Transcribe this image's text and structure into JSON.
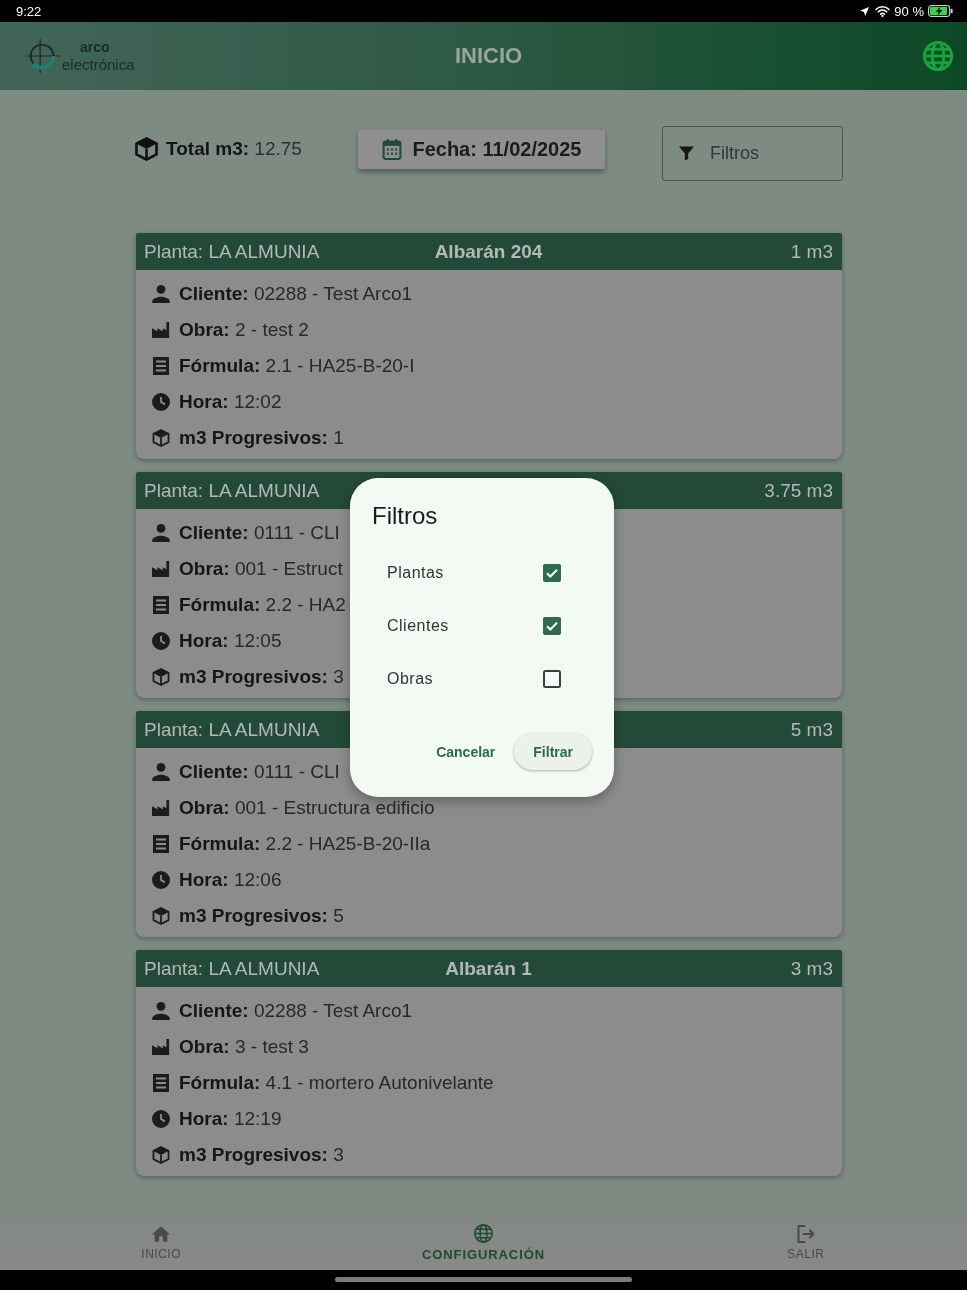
{
  "status_bar": {
    "time": "9:22",
    "battery": "90 %"
  },
  "app_bar": {
    "logo_top": "arco",
    "logo_bottom": "electrónica",
    "title": "INICIO"
  },
  "summary": {
    "total": "**Total m3:** 12.75",
    "date_button": "Fecha: 11/02/2025",
    "filter_button": "Filtros"
  },
  "cards": [
    {
      "plant": "Planta: LA ALMUNIA",
      "delivery_note": "Albarán 204",
      "volume": "1 m3",
      "rows": [
        {
          "kind": "client",
          "text": "**Cliente:** 02288 - Test Arco1"
        },
        {
          "kind": "site",
          "text": "**Obra:** 2 - test 2"
        },
        {
          "kind": "formula",
          "text": "**Fórmula:** 2.1 - HA25-B-20-I"
        },
        {
          "kind": "time",
          "text": "**Hora:** 12:02"
        },
        {
          "kind": "volume",
          "text": "**m3 Progresivos:** 1"
        }
      ]
    },
    {
      "plant": "Planta: LA ALMUNIA",
      "volume": "3.75 m3",
      "rows": [
        {
          "kind": "client",
          "text": "**Cliente:** 0111 - CLI"
        },
        {
          "kind": "site",
          "text": "**Obra:** 001 - Estruct"
        },
        {
          "kind": "formula",
          "text": "**Fórmula:** 2.2 - HA2"
        },
        {
          "kind": "time",
          "text": "**Hora:** 12:05"
        },
        {
          "kind": "volume",
          "text": "**m3 Progresivos:** 3"
        }
      ]
    },
    {
      "plant": "Planta: LA ALMUNIA",
      "volume": "5 m3",
      "rows": [
        {
          "kind": "client",
          "text": "**Cliente:** 0111 - CLI"
        },
        {
          "kind": "site",
          "text": "**Obra:** 001 - Estructura edificio"
        },
        {
          "kind": "formula",
          "text": "**Fórmula:** 2.2 - HA25-B-20-IIa"
        },
        {
          "kind": "time",
          "text": "**Hora:** 12:06"
        },
        {
          "kind": "volume",
          "text": "**m3 Progresivos:** 5"
        }
      ]
    },
    {
      "plant": "Planta: LA ALMUNIA",
      "delivery_note": "Albarán 1",
      "volume": "3 m3",
      "rows": [
        {
          "kind": "client",
          "text": "**Cliente:** 02288 - Test Arco1"
        },
        {
          "kind": "site",
          "text": "**Obra:** 3 - test 3"
        },
        {
          "kind": "formula",
          "text": "**Fórmula:** 4.1 - mortero Autonivelante"
        },
        {
          "kind": "time",
          "text": "**Hora:** 12:19"
        },
        {
          "kind": "volume",
          "text": "**m3 Progresivos:** 3"
        }
      ]
    }
  ],
  "dialog": {
    "title": "Filtros",
    "options": [
      {
        "label": "Plantas",
        "checked": true
      },
      {
        "label": "Clientes",
        "checked": true
      },
      {
        "label": "Obras",
        "checked": false
      }
    ],
    "buttons": [
      {
        "kind": "text",
        "label": "Cancelar"
      },
      {
        "kind": "tonal",
        "label": "Filtrar"
      }
    ]
  },
  "bottom_nav": [
    {
      "kind": "home",
      "label": "INICIO",
      "selected": false
    },
    {
      "kind": "globe",
      "label": "CONFIGURACIÓN",
      "selected": true
    },
    {
      "kind": "logout",
      "label": "SALIR",
      "selected": false
    }
  ]
}
